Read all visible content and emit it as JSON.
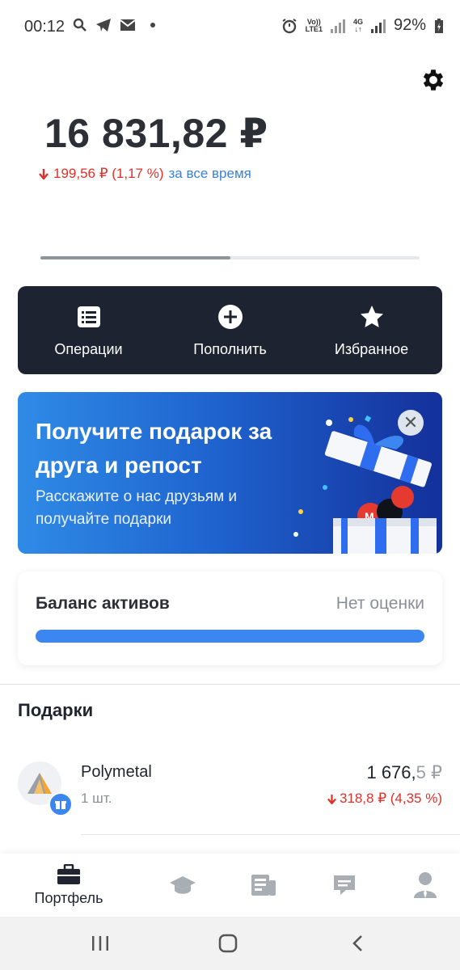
{
  "status_bar": {
    "time": "00:12",
    "battery": "92%",
    "network_1_top": "Vo))",
    "network_1_bottom": "LTE1",
    "network_2_top": "4G",
    "network_2_bottom": "↓↑"
  },
  "header": {
    "total_balance": "16 831,82 ₽",
    "change_value": "199,56 ₽ (1,17 %)",
    "change_period": "за все время",
    "carousel_position": 0.5
  },
  "actions": [
    {
      "label": "Операции",
      "icon": "list-icon"
    },
    {
      "label": "Пополнить",
      "icon": "plus-circle-icon"
    },
    {
      "label": "Избранное",
      "icon": "star-icon"
    }
  ],
  "promo": {
    "title": "Получите подарок за друга и репост",
    "text": "Расскажите о нас друзьям и получайте подарки",
    "close": "✕"
  },
  "assets_balance": {
    "title": "Баланс активов",
    "status": "Нет оценки"
  },
  "gifts": {
    "title": "Подарки",
    "items": [
      {
        "name": "Polymetal",
        "quantity": "1 шт.",
        "price_main": "1 676,",
        "price_tail": "5 ₽",
        "change": "318,8 ₽ (4,35 %)"
      }
    ]
  },
  "bottom_nav": {
    "active_label": "Портфель",
    "items": [
      "briefcase-icon",
      "graduation-cap-icon",
      "news-icon",
      "chat-icon",
      "profile-icon"
    ]
  },
  "colors": {
    "accent_blue": "#3b86f0",
    "negative_red": "#e0302a",
    "dark_panel": "#1d2331"
  }
}
